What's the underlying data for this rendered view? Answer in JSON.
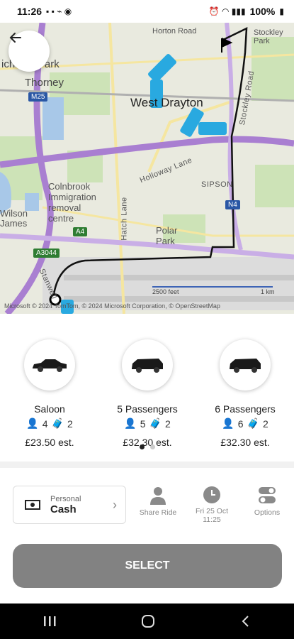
{
  "status_bar": {
    "time": "11:26",
    "battery": "100%"
  },
  "map": {
    "labels": {
      "horton_road": "Horton Road",
      "stockley_park": "Stockley\nPark",
      "richings_park": "ichings Park",
      "thorney": "Thorney",
      "west_drayton": "West Drayton",
      "holloway_lane": "Holloway Lane",
      "sipson": "SIPSON",
      "colnbrook": "Colnbrook\nImmigration\nremoval\ncentre",
      "wilson": "Wilson\nJames",
      "hatch_lane": "Hatch Lane",
      "polar_park": "Polar\nPark",
      "stockley_road": "Stockley Road",
      "stanwell": "Stanwell"
    },
    "badges": {
      "m25": "M25",
      "a4": "A4",
      "a3044": "A3044",
      "n4": "N4"
    },
    "scale": {
      "feet": "2500 feet",
      "km": "1 km"
    },
    "attribution": "Microsoft  © 2024 TomTom, © 2024 Microsoft Corporation, © OpenStreetMap"
  },
  "vehicles": [
    {
      "name": "Saloon",
      "passengers": "4",
      "luggage": "2",
      "price": "£23.50 est."
    },
    {
      "name": "5 Passengers",
      "passengers": "5",
      "luggage": "2",
      "price": "£32.30 est."
    },
    {
      "name": "6 Passengers",
      "passengers": "6",
      "luggage": "2",
      "price": "£32.30 est."
    }
  ],
  "payment": {
    "type": "Personal",
    "method": "Cash"
  },
  "options": {
    "share_ride": "Share Ride",
    "date": "Fri 25 Oct",
    "time": "11:25",
    "options": "Options"
  },
  "select_label": "SELECT",
  "colors": {
    "accent_taxi": "#29a9e0",
    "select_bg": "#828282",
    "route": "#111111"
  }
}
